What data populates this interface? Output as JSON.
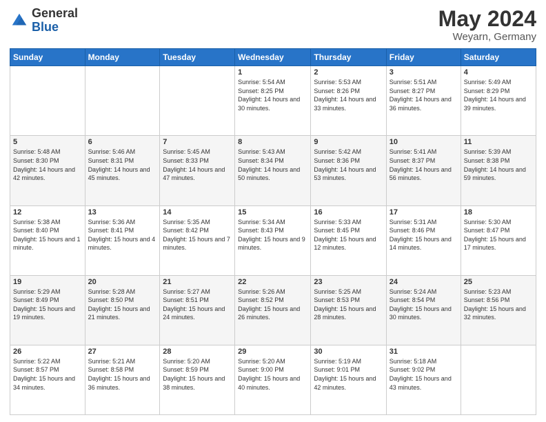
{
  "header": {
    "logo_general": "General",
    "logo_blue": "Blue",
    "month_title": "May 2024",
    "location": "Weyarn, Germany"
  },
  "days_of_week": [
    "Sunday",
    "Monday",
    "Tuesday",
    "Wednesday",
    "Thursday",
    "Friday",
    "Saturday"
  ],
  "weeks": [
    [
      {
        "day": "",
        "sunrise": "",
        "sunset": "",
        "daylight": ""
      },
      {
        "day": "",
        "sunrise": "",
        "sunset": "",
        "daylight": ""
      },
      {
        "day": "",
        "sunrise": "",
        "sunset": "",
        "daylight": ""
      },
      {
        "day": "1",
        "sunrise": "Sunrise: 5:54 AM",
        "sunset": "Sunset: 8:25 PM",
        "daylight": "Daylight: 14 hours and 30 minutes."
      },
      {
        "day": "2",
        "sunrise": "Sunrise: 5:53 AM",
        "sunset": "Sunset: 8:26 PM",
        "daylight": "Daylight: 14 hours and 33 minutes."
      },
      {
        "day": "3",
        "sunrise": "Sunrise: 5:51 AM",
        "sunset": "Sunset: 8:27 PM",
        "daylight": "Daylight: 14 hours and 36 minutes."
      },
      {
        "day": "4",
        "sunrise": "Sunrise: 5:49 AM",
        "sunset": "Sunset: 8:29 PM",
        "daylight": "Daylight: 14 hours and 39 minutes."
      }
    ],
    [
      {
        "day": "5",
        "sunrise": "Sunrise: 5:48 AM",
        "sunset": "Sunset: 8:30 PM",
        "daylight": "Daylight: 14 hours and 42 minutes."
      },
      {
        "day": "6",
        "sunrise": "Sunrise: 5:46 AM",
        "sunset": "Sunset: 8:31 PM",
        "daylight": "Daylight: 14 hours and 45 minutes."
      },
      {
        "day": "7",
        "sunrise": "Sunrise: 5:45 AM",
        "sunset": "Sunset: 8:33 PM",
        "daylight": "Daylight: 14 hours and 47 minutes."
      },
      {
        "day": "8",
        "sunrise": "Sunrise: 5:43 AM",
        "sunset": "Sunset: 8:34 PM",
        "daylight": "Daylight: 14 hours and 50 minutes."
      },
      {
        "day": "9",
        "sunrise": "Sunrise: 5:42 AM",
        "sunset": "Sunset: 8:36 PM",
        "daylight": "Daylight: 14 hours and 53 minutes."
      },
      {
        "day": "10",
        "sunrise": "Sunrise: 5:41 AM",
        "sunset": "Sunset: 8:37 PM",
        "daylight": "Daylight: 14 hours and 56 minutes."
      },
      {
        "day": "11",
        "sunrise": "Sunrise: 5:39 AM",
        "sunset": "Sunset: 8:38 PM",
        "daylight": "Daylight: 14 hours and 59 minutes."
      }
    ],
    [
      {
        "day": "12",
        "sunrise": "Sunrise: 5:38 AM",
        "sunset": "Sunset: 8:40 PM",
        "daylight": "Daylight: 15 hours and 1 minute."
      },
      {
        "day": "13",
        "sunrise": "Sunrise: 5:36 AM",
        "sunset": "Sunset: 8:41 PM",
        "daylight": "Daylight: 15 hours and 4 minutes."
      },
      {
        "day": "14",
        "sunrise": "Sunrise: 5:35 AM",
        "sunset": "Sunset: 8:42 PM",
        "daylight": "Daylight: 15 hours and 7 minutes."
      },
      {
        "day": "15",
        "sunrise": "Sunrise: 5:34 AM",
        "sunset": "Sunset: 8:43 PM",
        "daylight": "Daylight: 15 hours and 9 minutes."
      },
      {
        "day": "16",
        "sunrise": "Sunrise: 5:33 AM",
        "sunset": "Sunset: 8:45 PM",
        "daylight": "Daylight: 15 hours and 12 minutes."
      },
      {
        "day": "17",
        "sunrise": "Sunrise: 5:31 AM",
        "sunset": "Sunset: 8:46 PM",
        "daylight": "Daylight: 15 hours and 14 minutes."
      },
      {
        "day": "18",
        "sunrise": "Sunrise: 5:30 AM",
        "sunset": "Sunset: 8:47 PM",
        "daylight": "Daylight: 15 hours and 17 minutes."
      }
    ],
    [
      {
        "day": "19",
        "sunrise": "Sunrise: 5:29 AM",
        "sunset": "Sunset: 8:49 PM",
        "daylight": "Daylight: 15 hours and 19 minutes."
      },
      {
        "day": "20",
        "sunrise": "Sunrise: 5:28 AM",
        "sunset": "Sunset: 8:50 PM",
        "daylight": "Daylight: 15 hours and 21 minutes."
      },
      {
        "day": "21",
        "sunrise": "Sunrise: 5:27 AM",
        "sunset": "Sunset: 8:51 PM",
        "daylight": "Daylight: 15 hours and 24 minutes."
      },
      {
        "day": "22",
        "sunrise": "Sunrise: 5:26 AM",
        "sunset": "Sunset: 8:52 PM",
        "daylight": "Daylight: 15 hours and 26 minutes."
      },
      {
        "day": "23",
        "sunrise": "Sunrise: 5:25 AM",
        "sunset": "Sunset: 8:53 PM",
        "daylight": "Daylight: 15 hours and 28 minutes."
      },
      {
        "day": "24",
        "sunrise": "Sunrise: 5:24 AM",
        "sunset": "Sunset: 8:54 PM",
        "daylight": "Daylight: 15 hours and 30 minutes."
      },
      {
        "day": "25",
        "sunrise": "Sunrise: 5:23 AM",
        "sunset": "Sunset: 8:56 PM",
        "daylight": "Daylight: 15 hours and 32 minutes."
      }
    ],
    [
      {
        "day": "26",
        "sunrise": "Sunrise: 5:22 AM",
        "sunset": "Sunset: 8:57 PM",
        "daylight": "Daylight: 15 hours and 34 minutes."
      },
      {
        "day": "27",
        "sunrise": "Sunrise: 5:21 AM",
        "sunset": "Sunset: 8:58 PM",
        "daylight": "Daylight: 15 hours and 36 minutes."
      },
      {
        "day": "28",
        "sunrise": "Sunrise: 5:20 AM",
        "sunset": "Sunset: 8:59 PM",
        "daylight": "Daylight: 15 hours and 38 minutes."
      },
      {
        "day": "29",
        "sunrise": "Sunrise: 5:20 AM",
        "sunset": "Sunset: 9:00 PM",
        "daylight": "Daylight: 15 hours and 40 minutes."
      },
      {
        "day": "30",
        "sunrise": "Sunrise: 5:19 AM",
        "sunset": "Sunset: 9:01 PM",
        "daylight": "Daylight: 15 hours and 42 minutes."
      },
      {
        "day": "31",
        "sunrise": "Sunrise: 5:18 AM",
        "sunset": "Sunset: 9:02 PM",
        "daylight": "Daylight: 15 hours and 43 minutes."
      },
      {
        "day": "",
        "sunrise": "",
        "sunset": "",
        "daylight": ""
      }
    ]
  ]
}
